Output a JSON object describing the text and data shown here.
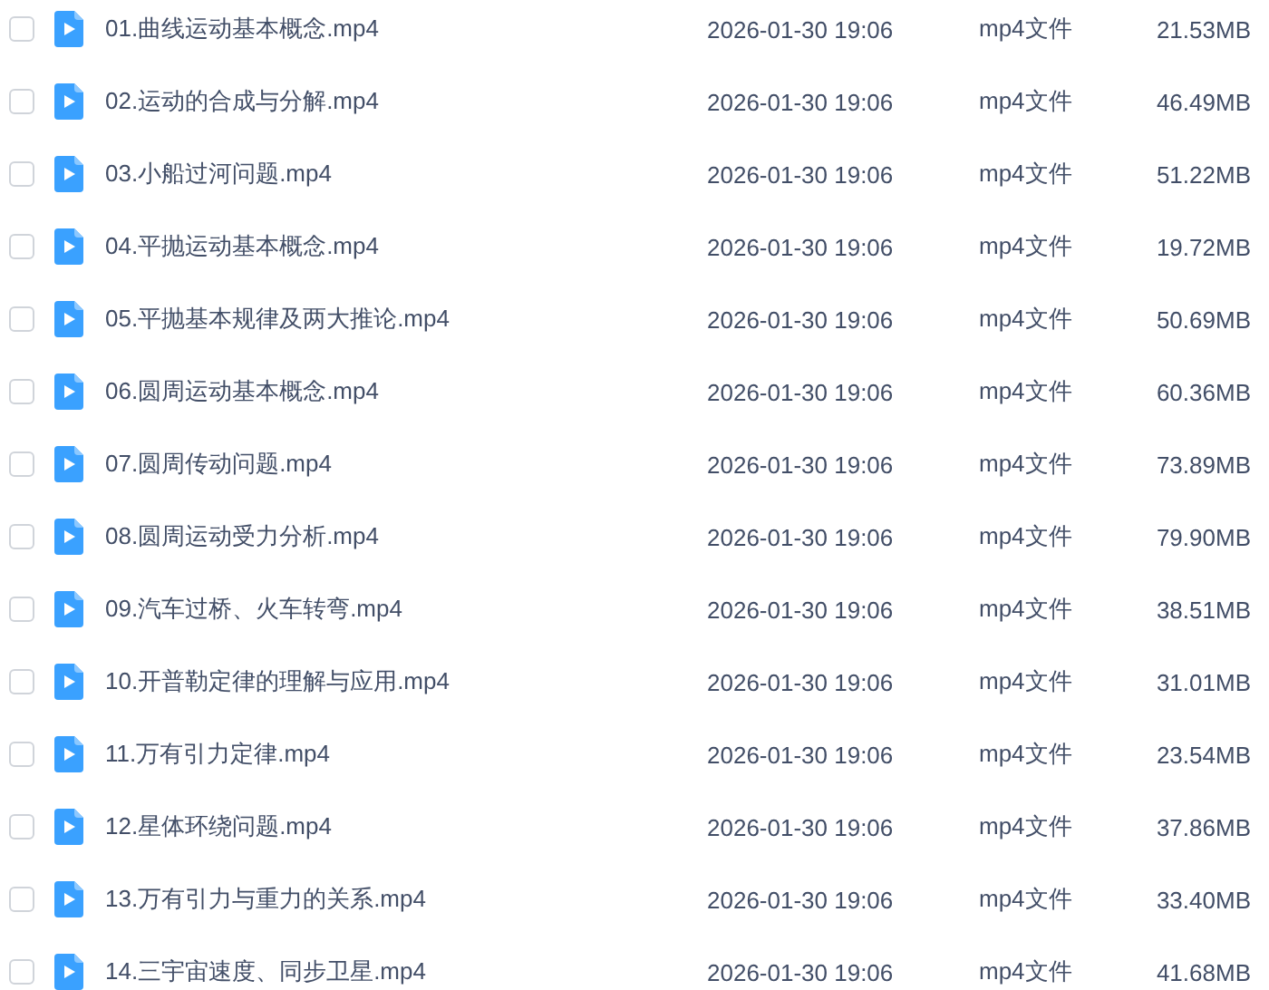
{
  "files": [
    {
      "checked": false,
      "name": "01.曲线运动基本概念.mp4",
      "modified": "2026-01-30 19:06",
      "type": "mp4文件",
      "size": "21.53MB"
    },
    {
      "checked": false,
      "name": "02.运动的合成与分解.mp4",
      "modified": "2026-01-30 19:06",
      "type": "mp4文件",
      "size": "46.49MB"
    },
    {
      "checked": false,
      "name": "03.小船过河问题.mp4",
      "modified": "2026-01-30 19:06",
      "type": "mp4文件",
      "size": "51.22MB"
    },
    {
      "checked": false,
      "name": "04.平抛运动基本概念.mp4",
      "modified": "2026-01-30 19:06",
      "type": "mp4文件",
      "size": "19.72MB"
    },
    {
      "checked": false,
      "name": "05.平抛基本规律及两大推论.mp4",
      "modified": "2026-01-30 19:06",
      "type": "mp4文件",
      "size": "50.69MB"
    },
    {
      "checked": false,
      "name": "06.圆周运动基本概念.mp4",
      "modified": "2026-01-30 19:06",
      "type": "mp4文件",
      "size": "60.36MB"
    },
    {
      "checked": false,
      "name": "07.圆周传动问题.mp4",
      "modified": "2026-01-30 19:06",
      "type": "mp4文件",
      "size": "73.89MB"
    },
    {
      "checked": false,
      "name": "08.圆周运动受力分析.mp4",
      "modified": "2026-01-30 19:06",
      "type": "mp4文件",
      "size": "79.90MB"
    },
    {
      "checked": false,
      "name": "09.汽车过桥、火车转弯.mp4",
      "modified": "2026-01-30 19:06",
      "type": "mp4文件",
      "size": "38.51MB"
    },
    {
      "checked": false,
      "name": "10.开普勒定律的理解与应用.mp4",
      "modified": "2026-01-30 19:06",
      "type": "mp4文件",
      "size": "31.01MB"
    },
    {
      "checked": false,
      "name": "11.万有引力定律.mp4",
      "modified": "2026-01-30 19:06",
      "type": "mp4文件",
      "size": "23.54MB"
    },
    {
      "checked": false,
      "name": "12.星体环绕问题.mp4",
      "modified": "2026-01-30 19:06",
      "type": "mp4文件",
      "size": "37.86MB"
    },
    {
      "checked": false,
      "name": "13.万有引力与重力的关系.mp4",
      "modified": "2026-01-30 19:06",
      "type": "mp4文件",
      "size": "33.40MB"
    },
    {
      "checked": false,
      "name": "14.三宇宙速度、同步卫星.mp4",
      "modified": "2026-01-30 19:06",
      "type": "mp4文件",
      "size": "41.68MB"
    }
  ]
}
